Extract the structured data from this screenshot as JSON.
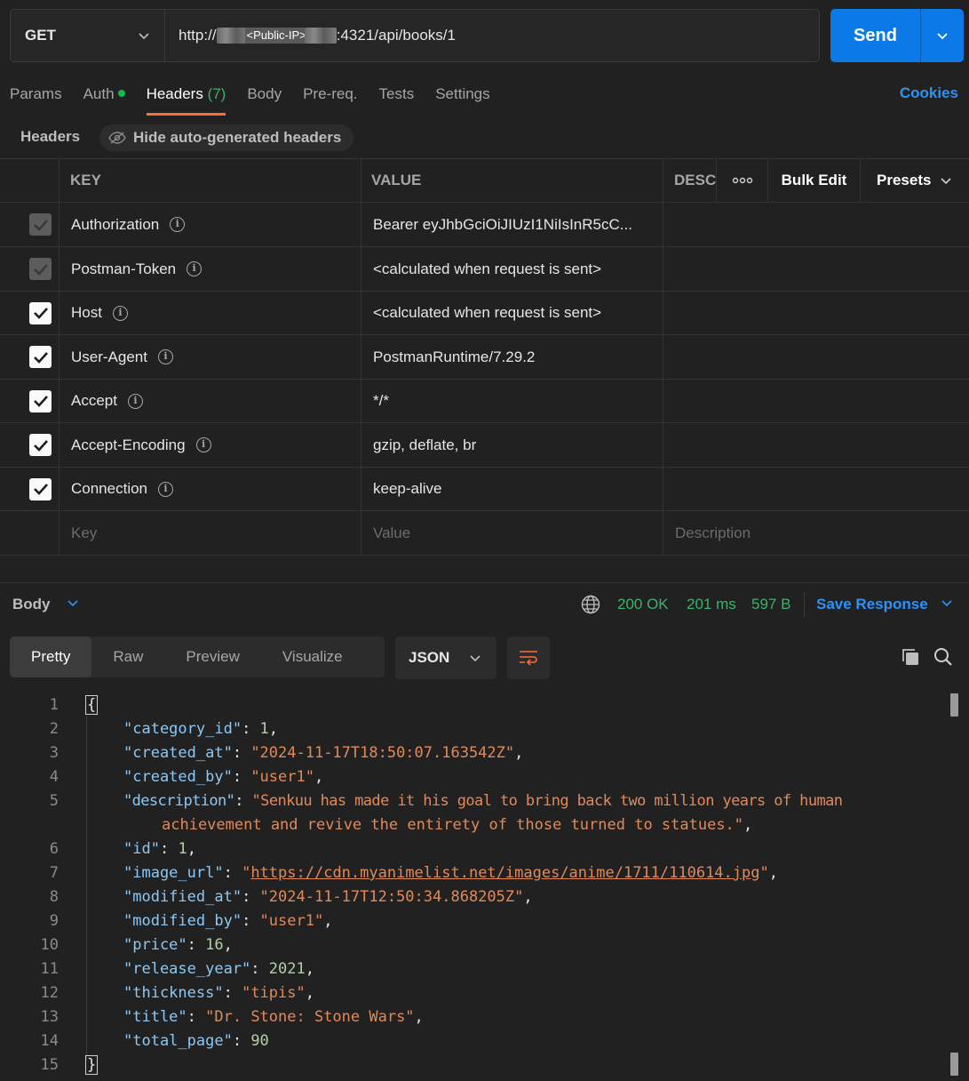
{
  "request": {
    "method": "GET",
    "url_prefix": "http://",
    "url_redacted": "<Public-IP>",
    "url_suffix": ":4321/api/books/1",
    "send_label": "Send"
  },
  "tabs": [
    {
      "label": "Params"
    },
    {
      "label": "Auth"
    },
    {
      "label": "Headers",
      "count": "(7)"
    },
    {
      "label": "Body"
    },
    {
      "label": "Pre-req."
    },
    {
      "label": "Tests"
    },
    {
      "label": "Settings"
    }
  ],
  "cookies_label": "Cookies",
  "headers_section": {
    "label": "Headers",
    "hide_auto_label": "Hide auto-generated headers"
  },
  "table": {
    "col_key": "KEY",
    "col_value": "VALUE",
    "col_desc": "DESC",
    "more": "ooo",
    "bulk_edit": "Bulk Edit",
    "presets": "Presets",
    "rows": [
      {
        "key": "Authorization",
        "value": "Bearer eyJhbGciOiJIUzI1NiIsInR5cC...",
        "checked": "disabled"
      },
      {
        "key": "Postman-Token",
        "value": "<calculated when request is sent>",
        "checked": "disabled"
      },
      {
        "key": "Host",
        "value": "<calculated when request is sent>",
        "checked": "on"
      },
      {
        "key": "User-Agent",
        "value": "PostmanRuntime/7.29.2",
        "checked": "on"
      },
      {
        "key": "Accept",
        "value": "*/*",
        "checked": "on"
      },
      {
        "key": "Accept-Encoding",
        "value": "gzip, deflate, br",
        "checked": "on"
      },
      {
        "key": "Connection",
        "value": "keep-alive",
        "checked": "on"
      }
    ],
    "placeholders": {
      "key": "Key",
      "value": "Value",
      "desc": "Description"
    }
  },
  "response": {
    "body_label": "Body",
    "status": "200 OK",
    "time": "201 ms",
    "size": "597 B",
    "save_label": "Save Response",
    "views": [
      "Pretty",
      "Raw",
      "Preview",
      "Visualize"
    ],
    "format": "JSON"
  },
  "code_lines": [
    {
      "n": "1"
    },
    {
      "n": "2"
    },
    {
      "n": "3"
    },
    {
      "n": "4"
    },
    {
      "n": "5"
    },
    {
      "n": ""
    },
    {
      "n": "6"
    },
    {
      "n": "7"
    },
    {
      "n": "8"
    },
    {
      "n": "9"
    },
    {
      "n": "10"
    },
    {
      "n": "11"
    },
    {
      "n": "12"
    },
    {
      "n": "13"
    },
    {
      "n": "14"
    },
    {
      "n": "15"
    }
  ],
  "json": {
    "k_category_id": "\"category_id\"",
    "v_category_id": "1",
    "k_created_at": "\"created_at\"",
    "v_created_at": "\"2024-11-17T18:50:07.163542Z\"",
    "k_created_by": "\"created_by\"",
    "v_created_by": "\"user1\"",
    "k_description": "\"description\"",
    "v_description_1": "\"Senkuu has made it his goal to bring back two million years of human",
    "v_description_2": "achievement and revive the entirety of those turned to statues.\"",
    "k_id": "\"id\"",
    "v_id": "1",
    "k_image_url": "\"image_url\"",
    "v_image_url": "https://cdn.myanimelist.net/images/anime/1711/110614.jpg",
    "k_modified_at": "\"modified_at\"",
    "v_modified_at": "\"2024-11-17T12:50:34.868205Z\"",
    "k_modified_by": "\"modified_by\"",
    "v_modified_by": "\"user1\"",
    "k_price": "\"price\"",
    "v_price": "16",
    "k_release_year": "\"release_year\"",
    "v_release_year": "2021",
    "k_thickness": "\"thickness\"",
    "v_thickness": "\"tipis\"",
    "k_title": "\"title\"",
    "v_title": "\"Dr. Stone: Stone Wars\"",
    "k_total_page": "\"total_page\"",
    "v_total_page": "90"
  },
  "colors": {
    "accent": "#ff6c37",
    "send": "#0b7ae6",
    "link": "#2d92f5",
    "status_ok": "#3fb06a"
  }
}
